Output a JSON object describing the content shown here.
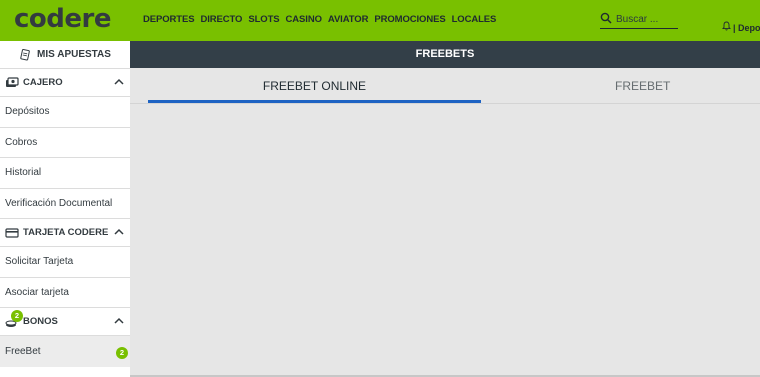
{
  "header": {
    "logo": "codere",
    "nav": [
      "DEPORTES",
      "DIRECTO",
      "SLOTS",
      "CASINO",
      "AVIATOR",
      "PROMOCIONES",
      "LOCALES"
    ],
    "search_placeholder": "Buscar ...",
    "right_text": "| Depo",
    "brand_color": "#79c000"
  },
  "sidebar": {
    "title": "MIS APUESTAS",
    "sections": [
      {
        "label": "CAJERO",
        "icon": "cash-icon",
        "items": [
          "Depósitos",
          "Cobros",
          "Historial",
          "Verificación Documental"
        ]
      },
      {
        "label": "TARJETA CODERE",
        "icon": "card-icon",
        "items": [
          "Solicitar Tarjeta",
          "Asociar tarjeta"
        ]
      },
      {
        "label": "BONOS",
        "icon": "coins-icon",
        "badge": "2",
        "items": [
          "FreeBet"
        ],
        "item_badge": "2"
      }
    ]
  },
  "main": {
    "title": "FREEBETS",
    "tabs": [
      {
        "label": "FREEBET ONLINE",
        "active": true
      },
      {
        "label": "FREEBET PRESENCIALES",
        "active": false
      }
    ],
    "tab_accent": "#1e63c3"
  }
}
